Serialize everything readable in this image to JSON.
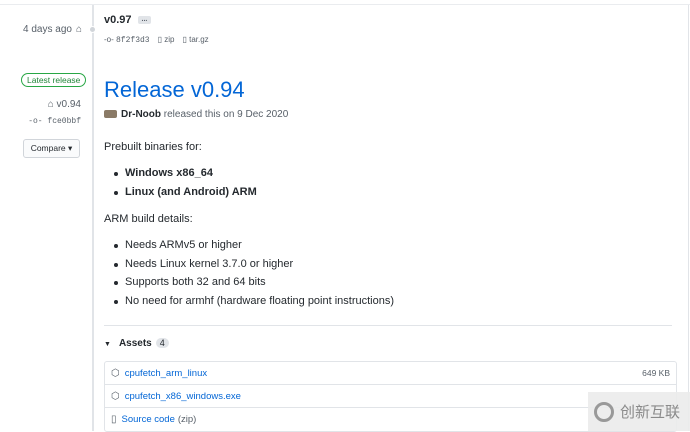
{
  "sidebar": {
    "prev_time": "4 days ago",
    "latest_badge": "Latest release",
    "tag": "v0.94",
    "commit": "fce0bbf",
    "compare_label": "Compare"
  },
  "prev_release": {
    "name": "v0.97",
    "more": "...",
    "commit": "8f2f3d3",
    "zip": "zip",
    "targz": "tar.gz"
  },
  "release": {
    "title": "Release v0.94",
    "author": "Dr-Noob",
    "released_text": "released this on 9 Dec 2020",
    "intro": "Prebuilt binaries for:",
    "binaries": [
      "Windows x86_64",
      "Linux (and Android) ARM"
    ],
    "arm_heading": "ARM build details:",
    "arm_details": [
      "Needs ARMv5 or higher",
      "Needs Linux kernel 3.7.0 or higher",
      "Supports both 32 and 64 bits",
      "No need for armhf (hardware floating point instructions)"
    ]
  },
  "assets": {
    "label": "Assets",
    "count": "4",
    "items": [
      {
        "name": "cpufetch_arm_linux",
        "size": "649 KB",
        "icon": "package-icon"
      },
      {
        "name": "cpufetch_x86_windows.exe",
        "size": "",
        "icon": "package-icon"
      },
      {
        "name": "Source code",
        "suffix": "(zip)",
        "icon": "file-zip-icon"
      }
    ]
  },
  "watermark": "创新互联"
}
